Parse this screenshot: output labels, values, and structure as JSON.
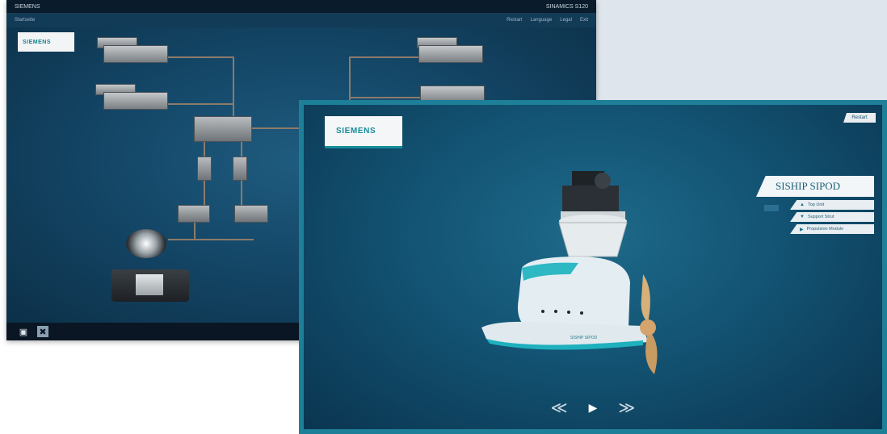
{
  "back_window": {
    "title_left": "SIEMENS",
    "title_right": "SINAMICS S120",
    "nav_label": "Startseite",
    "menu_links": [
      "Restart",
      "Language",
      "Legal",
      "Exit"
    ],
    "logo": "SIEMENS",
    "footer_icons": [
      "cabinet-icon",
      "tools-icon"
    ]
  },
  "front_window": {
    "logo": "SIEMENS",
    "restart_button": "Restart",
    "product_title": "SISHIP SIPOD",
    "menu_items": [
      {
        "icon": "pod-icon",
        "label": "Top Unit"
      },
      {
        "icon": "support-icon",
        "label": "Support Strut"
      },
      {
        "icon": "propulsion-icon",
        "label": "Propulsion Module"
      }
    ],
    "pod_label": "SISHIP SIPOD",
    "controls": {
      "previous": "≪",
      "play": "▶",
      "next": "≫"
    }
  }
}
